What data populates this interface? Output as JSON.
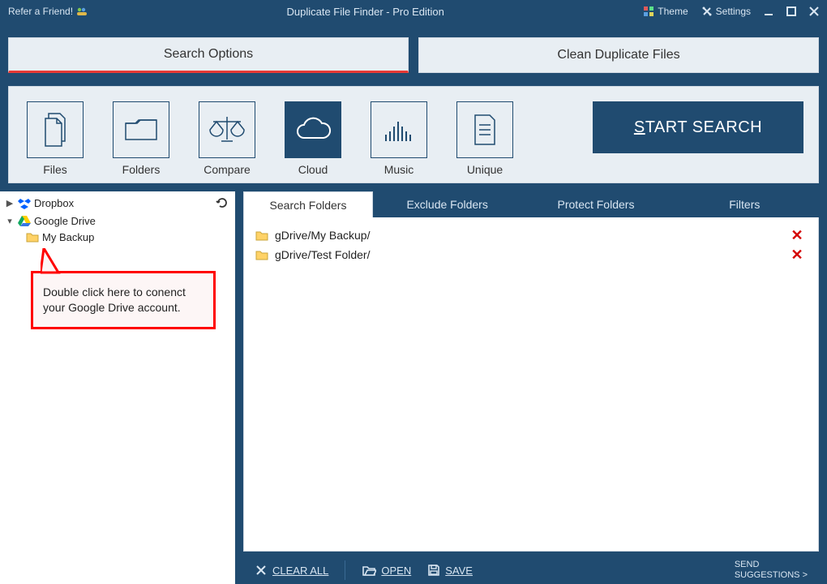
{
  "titlebar": {
    "refer": "Refer a Friend!",
    "title": "Duplicate File Finder - Pro Edition",
    "theme": "Theme",
    "settings": "Settings"
  },
  "toptabs": {
    "search_options": "Search Options",
    "clean_duplicates": "Clean Duplicate Files"
  },
  "tools": {
    "files": "Files",
    "folders": "Folders",
    "compare": "Compare",
    "cloud": "Cloud",
    "music": "Music",
    "unique": "Unique"
  },
  "start_button_rest": "TART SEARCH",
  "tree": {
    "dropbox": "Dropbox",
    "gdrive": "Google Drive",
    "backup": "My Backup"
  },
  "callout": "Double click here to conenct your Google Drive account.",
  "subtabs": {
    "search": "Search Folders",
    "exclude": "Exclude Folders",
    "protect": "Protect Folders",
    "filters": "Filters"
  },
  "folders": [
    "gDrive/My Backup/",
    "gDrive/Test Folder/"
  ],
  "bottom": {
    "clear": "CLEAR ALL",
    "open": "OPEN",
    "save": "SAVE",
    "send1": "SEND",
    "send2": "SUGGESTIONS >"
  }
}
